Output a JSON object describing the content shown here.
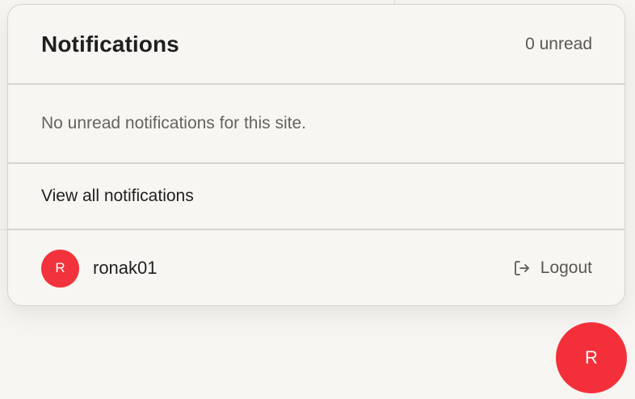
{
  "notifications": {
    "title": "Notifications",
    "unread_count": "0 unread",
    "empty_message": "No unread notifications for this site.",
    "view_all_label": "View all notifications"
  },
  "user": {
    "avatar_initial": "R",
    "username": "ronak01",
    "logout_label": "Logout",
    "logout_icon": "logout-arrow-icon"
  },
  "fab": {
    "initial": "R"
  },
  "colors": {
    "avatar": "#f2333b",
    "fab": "#f3303a",
    "panel_bg": "#f8f6f2",
    "border": "#d8d4cc"
  }
}
